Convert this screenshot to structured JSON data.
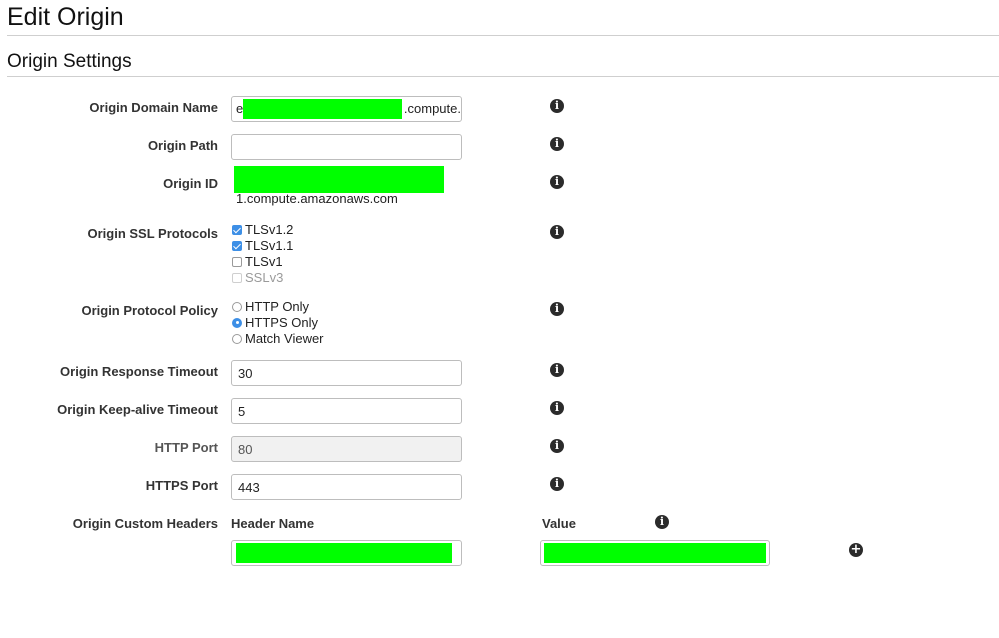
{
  "page": {
    "title": "Edit Origin"
  },
  "section": {
    "title": "Origin Settings"
  },
  "fields": {
    "origin_domain_name": {
      "label": "Origin Domain Name",
      "value_prefix": "e",
      "value_suffix": ".compute."
    },
    "origin_path": {
      "label": "Origin Path",
      "value": ""
    },
    "origin_id": {
      "label": "Origin ID",
      "value_suffix": "1.compute.amazonaws.com"
    },
    "origin_ssl_protocols": {
      "label": "Origin SSL Protocols",
      "options": [
        {
          "label": "TLSv1.2",
          "checked": true,
          "disabled": false
        },
        {
          "label": "TLSv1.1",
          "checked": true,
          "disabled": false
        },
        {
          "label": "TLSv1",
          "checked": false,
          "disabled": false
        },
        {
          "label": "SSLv3",
          "checked": false,
          "disabled": true
        }
      ]
    },
    "origin_protocol_policy": {
      "label": "Origin Protocol Policy",
      "options": [
        {
          "label": "HTTP Only",
          "selected": false
        },
        {
          "label": "HTTPS Only",
          "selected": true
        },
        {
          "label": "Match Viewer",
          "selected": false
        }
      ]
    },
    "origin_response_timeout": {
      "label": "Origin Response Timeout",
      "value": "30"
    },
    "origin_keepalive_timeout": {
      "label": "Origin Keep-alive Timeout",
      "value": "5"
    },
    "http_port": {
      "label": "HTTP Port",
      "value": "80",
      "disabled": true
    },
    "https_port": {
      "label": "HTTPS Port",
      "value": "443"
    },
    "origin_custom_headers": {
      "label": "Origin Custom Headers",
      "header_name_col": "Header Name",
      "value_col": "Value"
    }
  },
  "icons": {
    "info": "info-circle-icon",
    "add": "plus-circle-icon"
  },
  "colors": {
    "checked_accent": "#3d8fe6",
    "redaction": "#00ff00"
  }
}
